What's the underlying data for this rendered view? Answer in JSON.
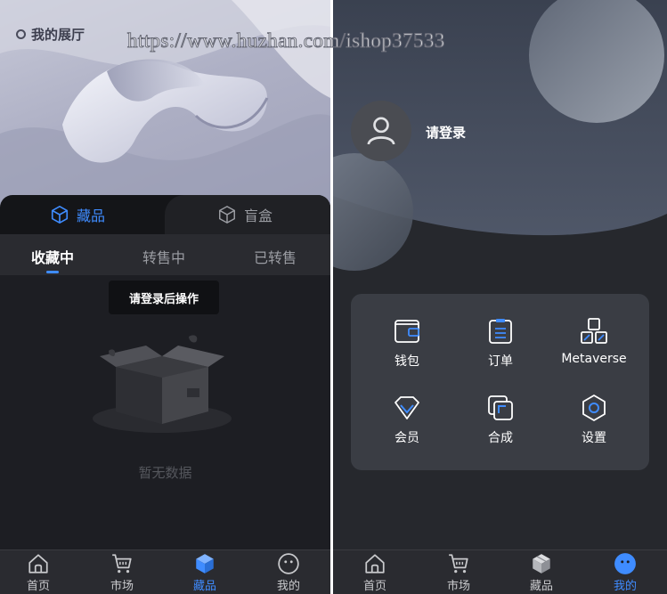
{
  "watermark": "https://www.huzhan.com/ishop37533",
  "left": {
    "hall_label": "我的展厅",
    "type_tabs": [
      {
        "label": "藏品",
        "active": true
      },
      {
        "label": "盲盒",
        "active": false
      }
    ],
    "status_tabs": [
      {
        "label": "收藏中",
        "active": true
      },
      {
        "label": "转售中",
        "active": false
      },
      {
        "label": "已转售",
        "active": false
      }
    ],
    "toast": "请登录后操作",
    "empty_text": "暂无数据",
    "nav": [
      {
        "label": "首页",
        "icon": "home-icon",
        "active": false
      },
      {
        "label": "市场",
        "icon": "cart-icon",
        "active": false
      },
      {
        "label": "藏品",
        "icon": "cube-icon",
        "active": true
      },
      {
        "label": "我的",
        "icon": "smile-icon",
        "active": false
      }
    ]
  },
  "right": {
    "login_label": "请登录",
    "menu": [
      {
        "label": "钱包",
        "icon": "wallet-icon"
      },
      {
        "label": "订单",
        "icon": "order-icon"
      },
      {
        "label": "Metaverse",
        "icon": "blocks-icon"
      },
      {
        "label": "会员",
        "icon": "diamond-icon"
      },
      {
        "label": "合成",
        "icon": "compose-icon"
      },
      {
        "label": "设置",
        "icon": "settings-icon"
      }
    ],
    "nav": [
      {
        "label": "首页",
        "icon": "home-icon",
        "active": false
      },
      {
        "label": "市场",
        "icon": "cart-icon",
        "active": false
      },
      {
        "label": "藏品",
        "icon": "cube-icon",
        "active": false
      },
      {
        "label": "我的",
        "icon": "smile-icon",
        "active": true
      }
    ]
  },
  "colors": {
    "accent": "#3f8cff",
    "panel": "#3a3d44",
    "background": "#1d1e23"
  }
}
